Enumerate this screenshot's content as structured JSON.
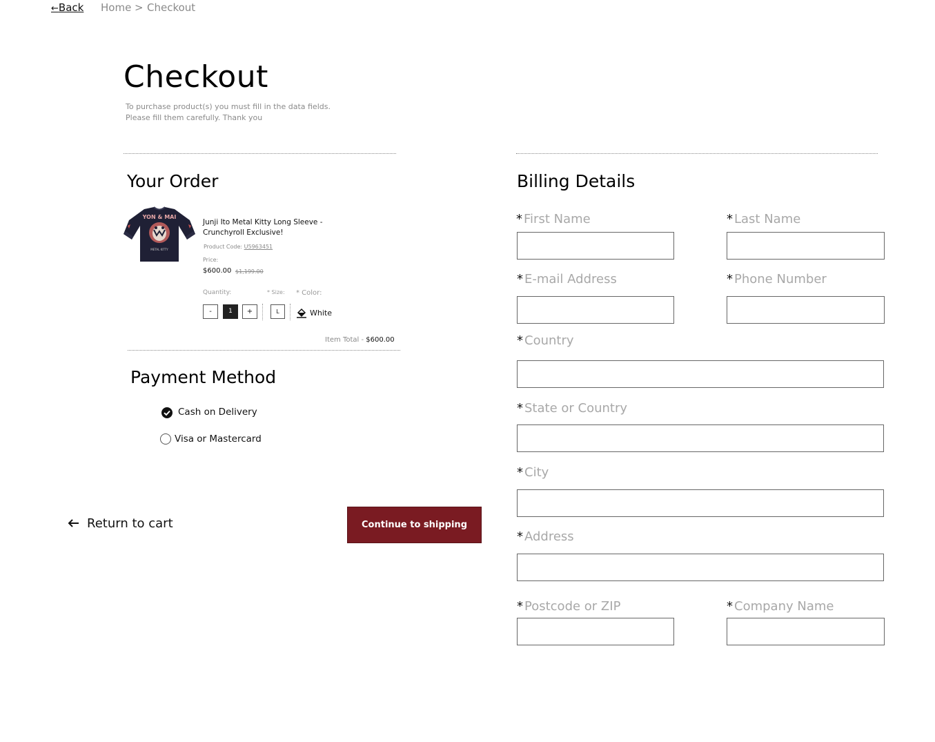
{
  "breadcrumb": {
    "back_label": "Back",
    "home_label": "Home",
    "separator": ">",
    "current_label": "Checkout"
  },
  "page": {
    "title": "Checkout",
    "subtitle_line1": "To purchase product(s) you must fill in the data fields.",
    "subtitle_line2": "Please fill them carefully. Thank you"
  },
  "order": {
    "title": "Your Order",
    "item": {
      "name_line1": "Junji Ito Metal Kitty Long Sleeve -",
      "name_line2": "Crunchyroll Exclusive!",
      "code_label": "Product Code:",
      "code_value": "U5963451",
      "price_label": "Price:",
      "price": "$600.00",
      "old_price": "$1,199.00",
      "quantity_label": "Quantity:",
      "qty_minus": "-",
      "qty_value": "1",
      "qty_plus": "+",
      "size_label": "* Size:",
      "size_value": "L",
      "color_label": "* Color:",
      "color_value": "White",
      "image_icon": "sweatshirt-image"
    },
    "item_total_label": "Item Total -",
    "item_total_value": "$600.00"
  },
  "payment": {
    "title": "Payment Method",
    "options": [
      {
        "label": "Cash on Delivery",
        "selected": true
      },
      {
        "label": "Visa or Mastercard",
        "selected": false
      }
    ]
  },
  "actions": {
    "return_label": "Return to cart",
    "continue_label": "Continue to shipping",
    "continue_color": "#7a1b22"
  },
  "billing": {
    "title": "Billing Details",
    "required_mark": "*",
    "fields": {
      "first_name": "First Name",
      "last_name": "Last Name",
      "email": "E-mail Address",
      "phone": "Phone Number",
      "country": "Country",
      "state": "State or Country",
      "city": "City",
      "address": "Address",
      "postcode": "Postcode or ZIP",
      "company": "Company Name"
    }
  }
}
